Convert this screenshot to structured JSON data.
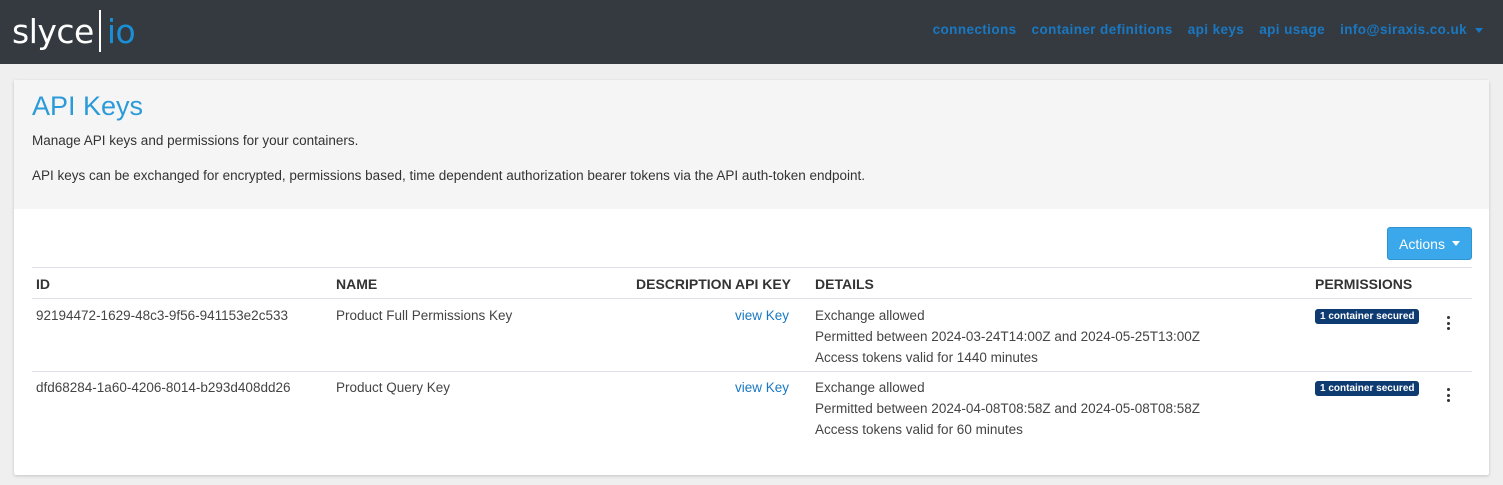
{
  "navbar": {
    "brand_left": "slyce",
    "brand_right": "io",
    "links": [
      "connections",
      "container definitions",
      "api keys",
      "api usage"
    ],
    "user_email": "info@siraxis.co.uk"
  },
  "page": {
    "title": "API Keys",
    "subtitle": "Manage API keys and permissions for your containers.",
    "description": "API keys can be exchanged for encrypted, permissions based, time dependent authorization bearer tokens via the API auth-token endpoint.",
    "actions_label": "Actions"
  },
  "table": {
    "headers": {
      "id": "ID",
      "name": "NAME",
      "description": "DESCRIPTION",
      "api_key": "API KEY",
      "details": "DETAILS",
      "permissions": "PERMISSIONS"
    },
    "rows": [
      {
        "id": "92194472-1629-48c3-9f56-941153e2c533",
        "name": "Product Full Permissions Key",
        "description": "",
        "api_key_link": "view Key",
        "details": [
          "Exchange allowed",
          "Permitted between 2024-03-24T14:00Z and 2024-05-25T13:00Z",
          "Access tokens valid for 1440 minutes"
        ],
        "permissions_badge": "1 container secured"
      },
      {
        "id": "dfd68284-1a60-4206-8014-b293d408dd26",
        "name": "Product Query Key",
        "description": "",
        "api_key_link": "view Key",
        "details": [
          "Exchange allowed",
          "Permitted between 2024-04-08T08:58Z and 2024-05-08T08:58Z",
          "Access tokens valid for 60 minutes"
        ],
        "permissions_badge": "1 container secured"
      }
    ]
  },
  "icons": [
    "chevron-down-icon",
    "kebab-menu-icon"
  ],
  "colors": {
    "navbar_bg": "#343a40",
    "brand_accent": "#1a8fd6",
    "nav_link": "#1a78c2",
    "title": "#2a9ad9",
    "actions_button": "#3aa8ea",
    "badge": "#0e3b72"
  }
}
